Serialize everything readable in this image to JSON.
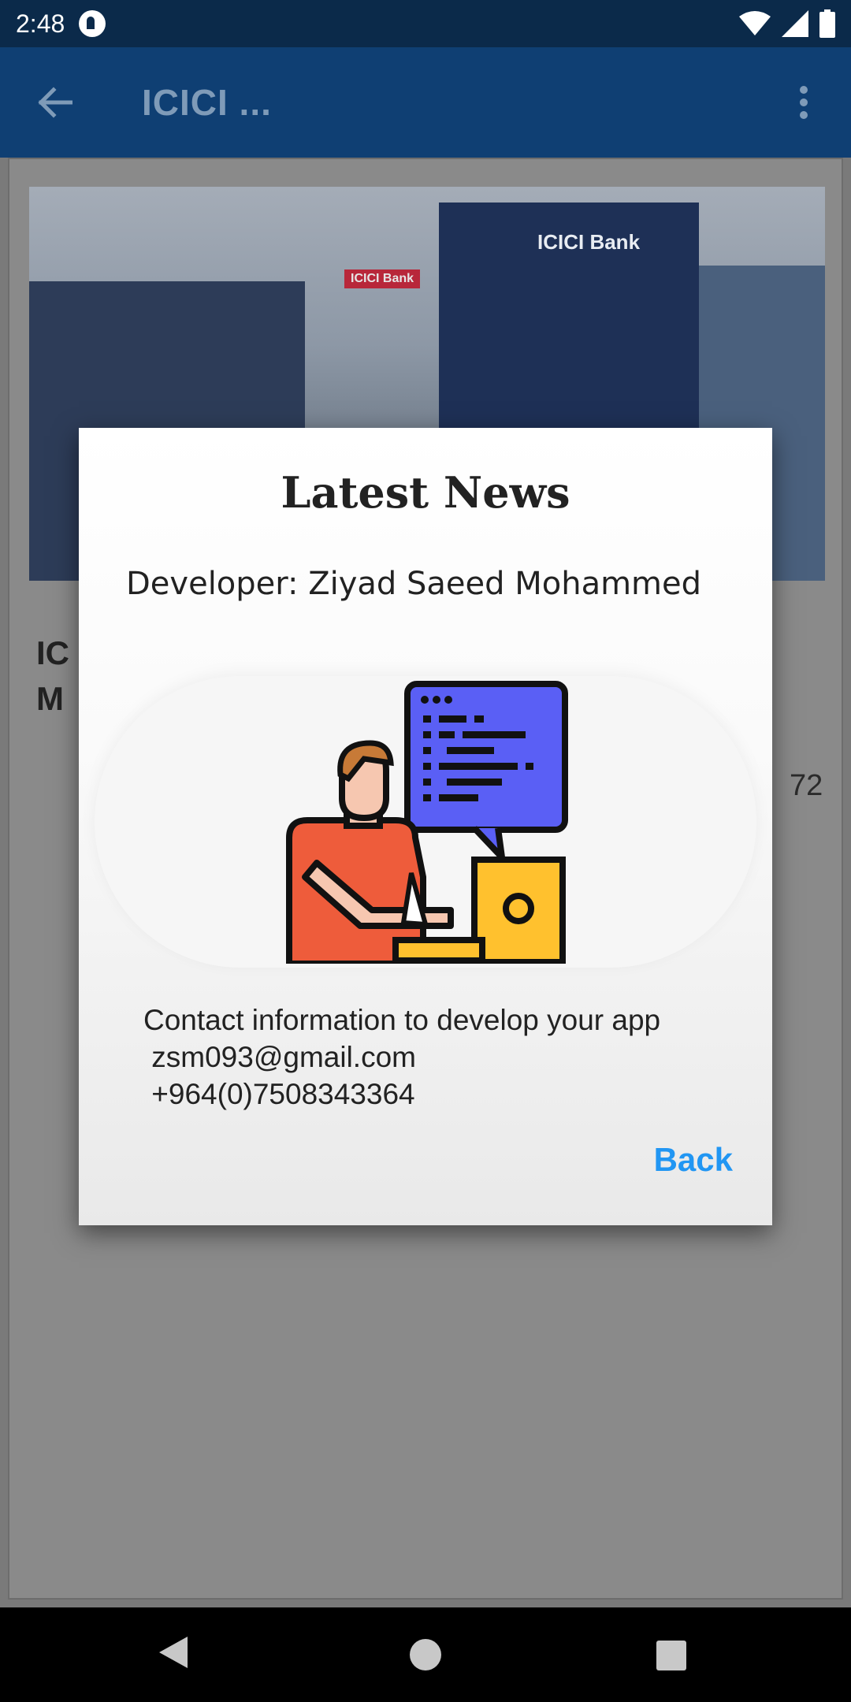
{
  "status_bar": {
    "time": "2:48"
  },
  "app_bar": {
    "title": "ICICI ..."
  },
  "page": {
    "hero_sign_main": "ICICI Bank",
    "hero_sign_small": "ICICI Bank",
    "heading_lines": [
      "IC",
      "M"
    ],
    "body_partial_right": "72"
  },
  "dialog": {
    "title": "Latest News",
    "developer": "Developer: Ziyad Saeed Mohammed",
    "contact": "Contact information to develop your app\n zsm093@gmail.com\n +964(0)7508343364",
    "back_label": "Back"
  },
  "colors": {
    "accent": "#2196F3",
    "app_bar": "#0f3f73",
    "status_bar": "#0b2a4a"
  }
}
